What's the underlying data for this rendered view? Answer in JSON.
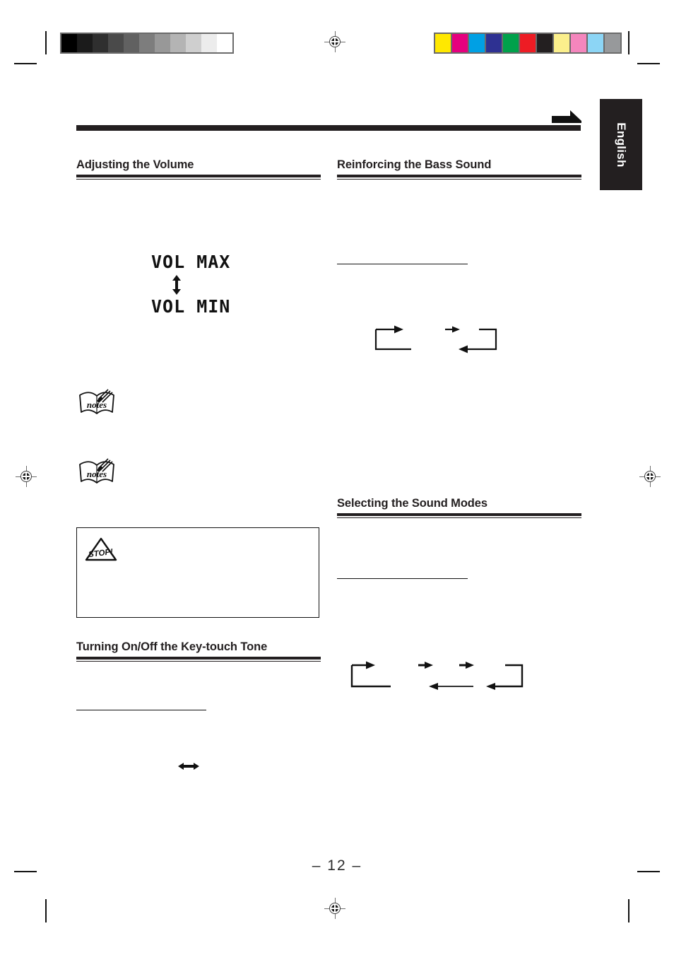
{
  "page": {
    "folio": "– 12 –",
    "language_tab": "English"
  },
  "calibration": {
    "grayscale_label": "grayscale-calibration-strip",
    "grayscale_patches": [
      "#000000",
      "#1b1b1b",
      "#2f2f2f",
      "#4a4a4a",
      "#616161",
      "#7d7d7d",
      "#989898",
      "#b4b4b4",
      "#cfcfcf",
      "#ececec",
      "#ffffff"
    ],
    "color_label": "color-calibration-strip",
    "color_patches": [
      "#ffe800",
      "#e5007e",
      "#00a0e4",
      "#2e3192",
      "#00a14b",
      "#ed1c24",
      "#231f20",
      "#fbef8c",
      "#f486bd",
      "#8cd5f5",
      "#97999b"
    ]
  },
  "sections": {
    "left": [
      {
        "id": "adjusting-volume",
        "title": "Adjusting the Volume"
      },
      {
        "id": "key-touch-tone",
        "title": "Turning On/Off the Key-touch Tone"
      }
    ],
    "right": [
      {
        "id": "reinforcing-bass",
        "title": "Reinforcing the Bass Sound"
      },
      {
        "id": "sound-modes",
        "title": "Selecting the Sound Modes"
      }
    ]
  },
  "lcd_display": {
    "line_top": "VOL MAX",
    "line_bottom": "VOL MIN",
    "arrow": "up-down-double-arrow"
  },
  "callouts": [
    {
      "id": "notes-1",
      "icon": "notes-icon",
      "label": "notes"
    },
    {
      "id": "notes-2",
      "icon": "notes-icon",
      "label": "notes"
    },
    {
      "id": "stop-1",
      "icon": "stop-icon",
      "label": "STOP!"
    }
  ],
  "diagrams": {
    "bass_cycle": {
      "id": "bass-sound-cycle",
      "type": "loop-flow",
      "arrows": 3
    },
    "sound_mode_cycle": {
      "id": "sound-mode-cycle",
      "type": "loop-flow",
      "arrows": 5
    },
    "key_touch_toggle": {
      "id": "key-touch-toggle",
      "type": "bidirectional-arrow"
    }
  }
}
